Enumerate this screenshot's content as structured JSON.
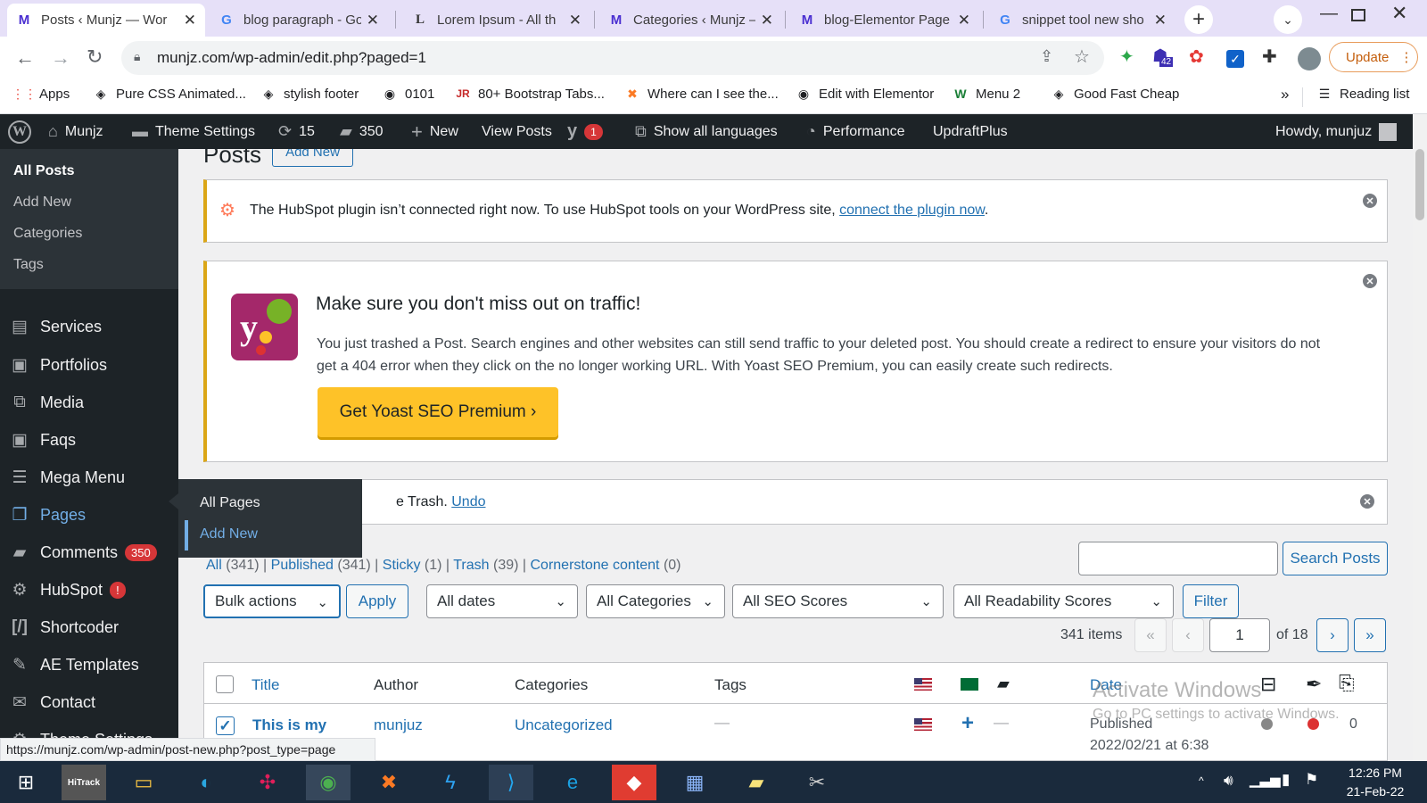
{
  "browser": {
    "tabs": [
      {
        "title": "Posts ‹ Munjz — Wor",
        "favicon": "M",
        "active": true
      },
      {
        "title": "blog paragraph - Go",
        "favicon": "G",
        "active": false
      },
      {
        "title": "Lorem Ipsum - All th",
        "favicon": "L",
        "active": false
      },
      {
        "title": "Categories ‹ Munjz –",
        "favicon": "M",
        "active": false
      },
      {
        "title": "blog-Elementor Page",
        "favicon": "M",
        "active": false
      },
      {
        "title": "snippet tool new sho",
        "favicon": "G",
        "active": false
      }
    ],
    "url": "munjz.com/wp-admin/edit.php?paged=1",
    "update_label": "Update",
    "extension_badge": "42",
    "bookmarks": [
      {
        "label": "Apps",
        "icon": "apps-grid-icon"
      },
      {
        "label": "Pure CSS Animated...",
        "icon": "codepen-icon"
      },
      {
        "label": "stylish footer",
        "icon": "codepen-icon"
      },
      {
        "label": "0101",
        "icon": "globe-icon"
      },
      {
        "label": "80+ Bootstrap Tabs...",
        "icon": "jr-icon"
      },
      {
        "label": "Where can I see the...",
        "icon": "xampp-icon"
      },
      {
        "label": "Edit with Elementor",
        "icon": "globe-icon"
      },
      {
        "label": "Menu 2",
        "icon": "wix-icon"
      },
      {
        "label": "Good Fast Cheap",
        "icon": "codepen-icon"
      }
    ],
    "bookmarks_more": "»",
    "reading_list": "Reading list",
    "status_url": "https://munjz.com/wp-admin/post-new.php?post_type=page"
  },
  "adminbar": {
    "site": "Munjz",
    "theme_settings": "Theme Settings",
    "updates_count": "15",
    "comments_count": "350",
    "new_label": "New",
    "view_posts": "View Posts",
    "yoast_badge": "1",
    "languages": "Show all languages",
    "performance": "Performance",
    "updraft": "UpdraftPlus",
    "howdy": "Howdy, munjuz"
  },
  "sidebar": {
    "posts_submenu": [
      "All Posts",
      "Add New",
      "Categories",
      "Tags"
    ],
    "items": [
      {
        "label": "Services",
        "icon": "document-icon"
      },
      {
        "label": "Portfolios",
        "icon": "gallery-icon"
      },
      {
        "label": "Media",
        "icon": "media-icon"
      },
      {
        "label": "Faqs",
        "icon": "gallery-icon"
      },
      {
        "label": "Mega Menu",
        "icon": "menu-lines-icon"
      },
      {
        "label": "Pages",
        "icon": "pages-icon"
      },
      {
        "label": "Comments",
        "icon": "comment-icon",
        "badge": "350"
      },
      {
        "label": "HubSpot",
        "icon": "hubspot-icon",
        "badge": "!"
      },
      {
        "label": "Shortcoder",
        "icon": "shortcode-icon"
      },
      {
        "label": "AE Templates",
        "icon": "pin-icon"
      },
      {
        "label": "Contact",
        "icon": "mail-icon"
      },
      {
        "label": "Theme Settings",
        "icon": "gear-icon"
      }
    ],
    "pages_flyout": [
      "All Pages",
      "Add New"
    ]
  },
  "page": {
    "heading": "Posts",
    "add_new": "Add New",
    "hubspot_notice": {
      "text": "The HubSpot plugin isn’t connected right now. To use HubSpot tools on your WordPress site, ",
      "link": "connect the plugin now",
      "end": "."
    },
    "yoast_notice": {
      "title": "Make sure you don't miss out on traffic!",
      "body": "You just trashed a Post. Search engines and other websites can still send traffic to your deleted post. You should create a redirect to ensure your visitors do not get a 404 error when they click on the no longer working URL. With Yoast SEO Premium, you can easily create such redirects.",
      "cta": "Get Yoast SEO Premium ›"
    },
    "trash_notice": {
      "text": "e Trash. ",
      "link": "Undo"
    },
    "filters": [
      {
        "label": "All",
        "count": "(341)"
      },
      {
        "label": "Published",
        "count": "(341)"
      },
      {
        "label": "Sticky",
        "count": "(1)"
      },
      {
        "label": "Trash",
        "count": "(39)"
      },
      {
        "label": "Cornerstone content",
        "count": "(0)"
      }
    ],
    "search_button": "Search Posts",
    "bulk_actions": "Bulk actions",
    "apply": "Apply",
    "all_dates": "All dates",
    "all_categories": "All Categories",
    "all_seo": "All SEO Scores",
    "all_readability": "All Readability Scores",
    "filter": "Filter",
    "items_count": "341 items",
    "pagination": {
      "first": "«",
      "prev": "‹",
      "current": "1",
      "of": "of 18",
      "next": "›",
      "last": "»"
    },
    "columns": {
      "title": "Title",
      "author": "Author",
      "categories": "Categories",
      "tags": "Tags",
      "date": "Date"
    },
    "row": {
      "title": "This is my",
      "author": "munjuz",
      "category": "Uncategorized",
      "tags": "—",
      "translation_add": "+",
      "comments_dash": "—",
      "status": "Published",
      "date": "2022/02/21 at 6:38",
      "links_count": "0"
    },
    "watermark": {
      "line1": "Activate Windows",
      "line2": "Go to PC settings to activate Windows."
    }
  },
  "taskbar": {
    "time": "12:26 PM",
    "date": "21-Feb-22"
  },
  "colors": {
    "wp_dark": "#1d2327",
    "wp_blue": "#2271b1",
    "yoast_purple": "#a4286a",
    "badge_red": "#d63638",
    "notice_yellow": "#dba617",
    "cta_yellow": "#fec228"
  }
}
